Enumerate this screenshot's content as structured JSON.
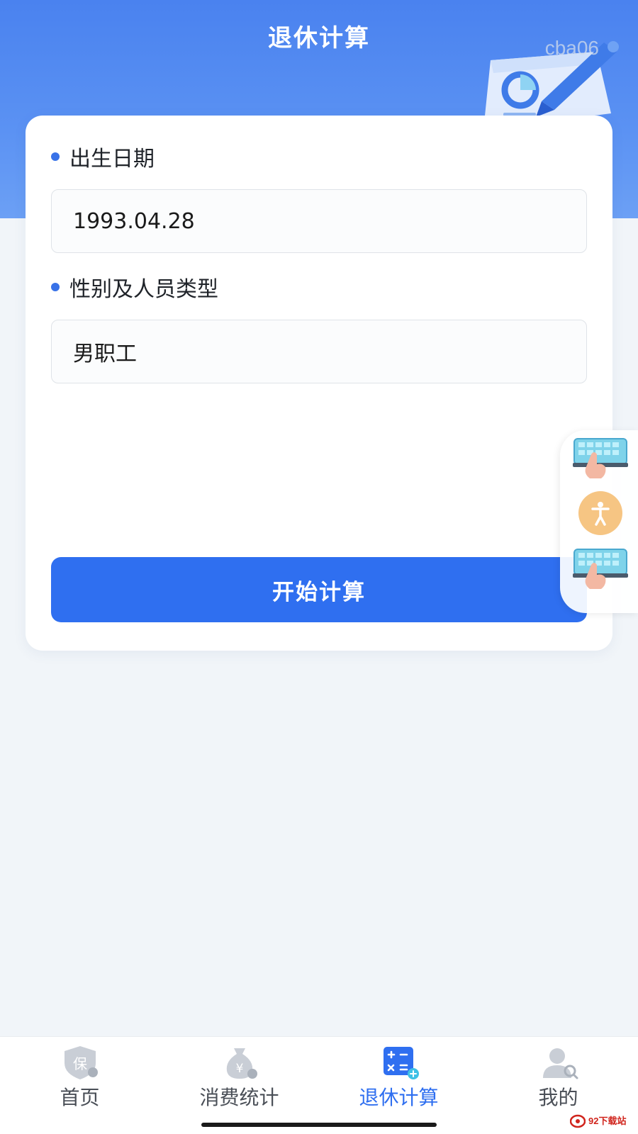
{
  "header": {
    "title": "退休计算",
    "watermark": "cba06"
  },
  "form": {
    "birth_date": {
      "label": "出生日期",
      "value": "1993.04.28"
    },
    "person_type": {
      "label": "性别及人员类型",
      "value": "男职工"
    },
    "submit_label": "开始计算"
  },
  "floating_tools": [
    {
      "icon": "keyboard-touch-icon"
    },
    {
      "icon": "accessibility-icon"
    },
    {
      "icon": "keyboard-touch-icon"
    }
  ],
  "bottom_nav": {
    "active_index": 2,
    "items": [
      {
        "label": "首页",
        "icon": "insurance-shield-icon"
      },
      {
        "label": "消费统计",
        "icon": "money-bag-icon"
      },
      {
        "label": "退休计算",
        "icon": "calculator-icon"
      },
      {
        "label": "我的",
        "icon": "user-profile-icon"
      }
    ]
  },
  "corner_logo": {
    "text": "92下载站"
  },
  "colors": {
    "accent": "#2f6ff0",
    "header": "#4a82ef",
    "page_bg": "#f1f5f9"
  }
}
